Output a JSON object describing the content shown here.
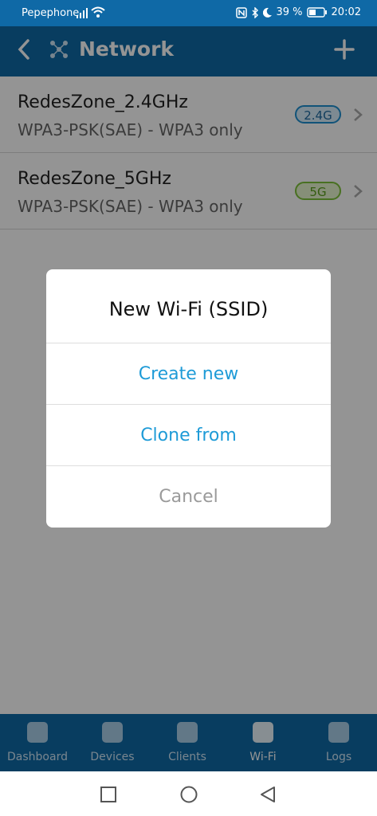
{
  "status_bar": {
    "carrier": "Pepephone",
    "battery": "39 %",
    "time": "20:02"
  },
  "app_bar": {
    "title": "Network"
  },
  "networks": [
    {
      "ssid": "RedesZone_2.4GHz",
      "security": "WPA3-PSK(SAE) - WPA3 only",
      "band": "2.4G"
    },
    {
      "ssid": "RedesZone_5GHz",
      "security": "WPA3-PSK(SAE) - WPA3 only",
      "band": "5G"
    }
  ],
  "dialog": {
    "title": "New Wi-Fi (SSID)",
    "create_new": "Create new",
    "clone_from": "Clone from",
    "cancel": "Cancel"
  },
  "tabs": [
    {
      "label": "Dashboard",
      "icon": "dashboard-icon"
    },
    {
      "label": "Devices",
      "icon": "devices-icon"
    },
    {
      "label": "Clients",
      "icon": "clients-icon"
    },
    {
      "label": "Wi-Fi",
      "icon": "wifi-icon",
      "active": true
    },
    {
      "label": "Logs",
      "icon": "logs-icon"
    }
  ],
  "colors": {
    "primary": "#0f69a6",
    "dialog_action": "#1e9bd7",
    "cancel": "#9a9a9a"
  }
}
